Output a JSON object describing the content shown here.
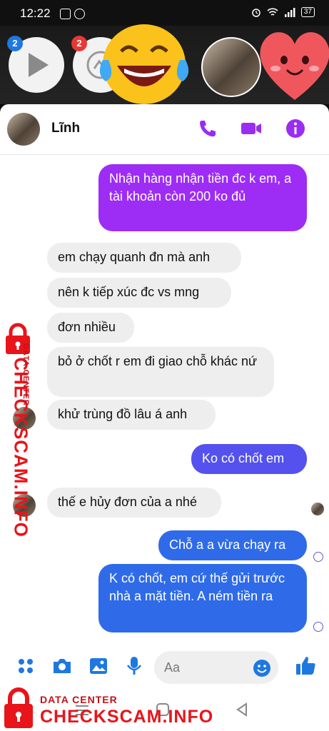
{
  "status_bar": {
    "time": "12:22",
    "battery": "37",
    "apps": [
      "Zalo",
      "Messenger"
    ]
  },
  "chat_heads": [
    {
      "badge": "2"
    },
    {
      "badge": "2"
    }
  ],
  "header": {
    "name": "Lĩnh"
  },
  "messages": [
    {
      "dir": "out",
      "text": "Nhận hàng nhận tiền đc k em, a tài khoản còn 200 ko đủ"
    },
    {
      "dir": "in",
      "text": "em chạy quanh đn mà anh"
    },
    {
      "dir": "in",
      "text": "nên k tiếp xúc đc vs mng"
    },
    {
      "dir": "in",
      "text": "đơn nhiều"
    },
    {
      "dir": "in",
      "text": "bỏ ở chốt r em đi giao chỗ khác nứ"
    },
    {
      "dir": "in",
      "text": "khử trùng đồ lâu á anh"
    },
    {
      "dir": "out",
      "text": "Ko có chốt em"
    },
    {
      "dir": "in",
      "text": "thế e hủy đơn của a nhé"
    },
    {
      "dir": "out",
      "text": "Chỗ a a vừa chạy ra"
    },
    {
      "dir": "out",
      "text": "K có chốt, em cứ thế gửi trước nhà a mặt tiền. A ném tiền ra"
    }
  ],
  "composer": {
    "placeholder": "Aa"
  },
  "watermark": {
    "label": "DATA CENTER",
    "brand": "CHECKSCAM.INFO"
  },
  "colors": {
    "accent": "#9b2cf2",
    "watermark": "#e8141a"
  },
  "icons": [
    "call-icon",
    "video-icon",
    "info-icon",
    "menu-dots-icon",
    "camera-icon",
    "gallery-icon",
    "mic-icon",
    "emoji-icon",
    "like-icon"
  ]
}
